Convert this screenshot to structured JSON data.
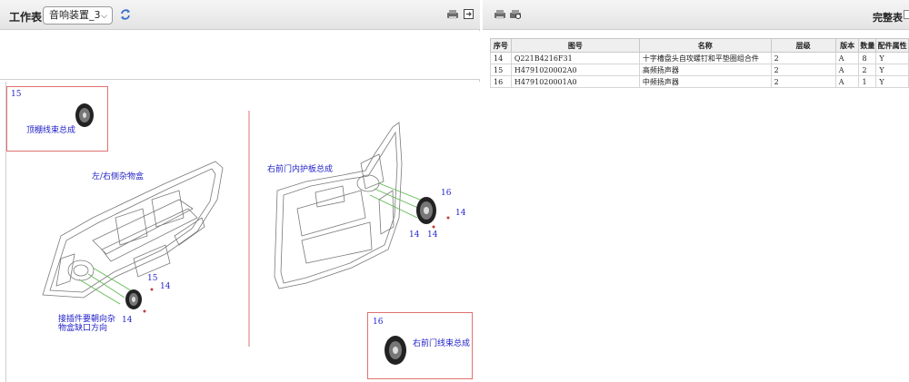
{
  "left_toolbar": {
    "worksheet_label": "工作表",
    "worksheet_value": "音响装置_3"
  },
  "drawing": {
    "callouts": [
      {
        "num": "15",
        "label": "顶棚线束总成"
      },
      {
        "num": "16",
        "label": "右前门线束总成"
      }
    ],
    "labels": {
      "left_assembly": "左/右侧杂物盒",
      "right_assembly": "右前门内护板总成",
      "note_line1": "接插件要朝向杂",
      "note_line2": "物盒缺口方向"
    },
    "part_numbers": {
      "p15": "15",
      "p14a": "14",
      "p14b": "14",
      "p16": "16",
      "p14c": "14",
      "p14d": "14",
      "p14e": "14"
    }
  },
  "right_toolbar": {
    "complete_label": "完整表"
  },
  "bom": {
    "columns": [
      "序号",
      "图号",
      "名称",
      "层级",
      "版本",
      "数量",
      "配件属性"
    ],
    "rows": [
      [
        "14",
        "Q221B4216F31",
        "十字槽盘头自攻螺钉和平垫圈组合件",
        "2",
        "A",
        "8",
        "Y"
      ],
      [
        "15",
        "H4791020002A0",
        "高频扬声器",
        "2",
        "A",
        "2",
        "Y"
      ],
      [
        "16",
        "H4791020001A0",
        "中频扬声器",
        "2",
        "A",
        "1",
        "Y"
      ]
    ]
  }
}
